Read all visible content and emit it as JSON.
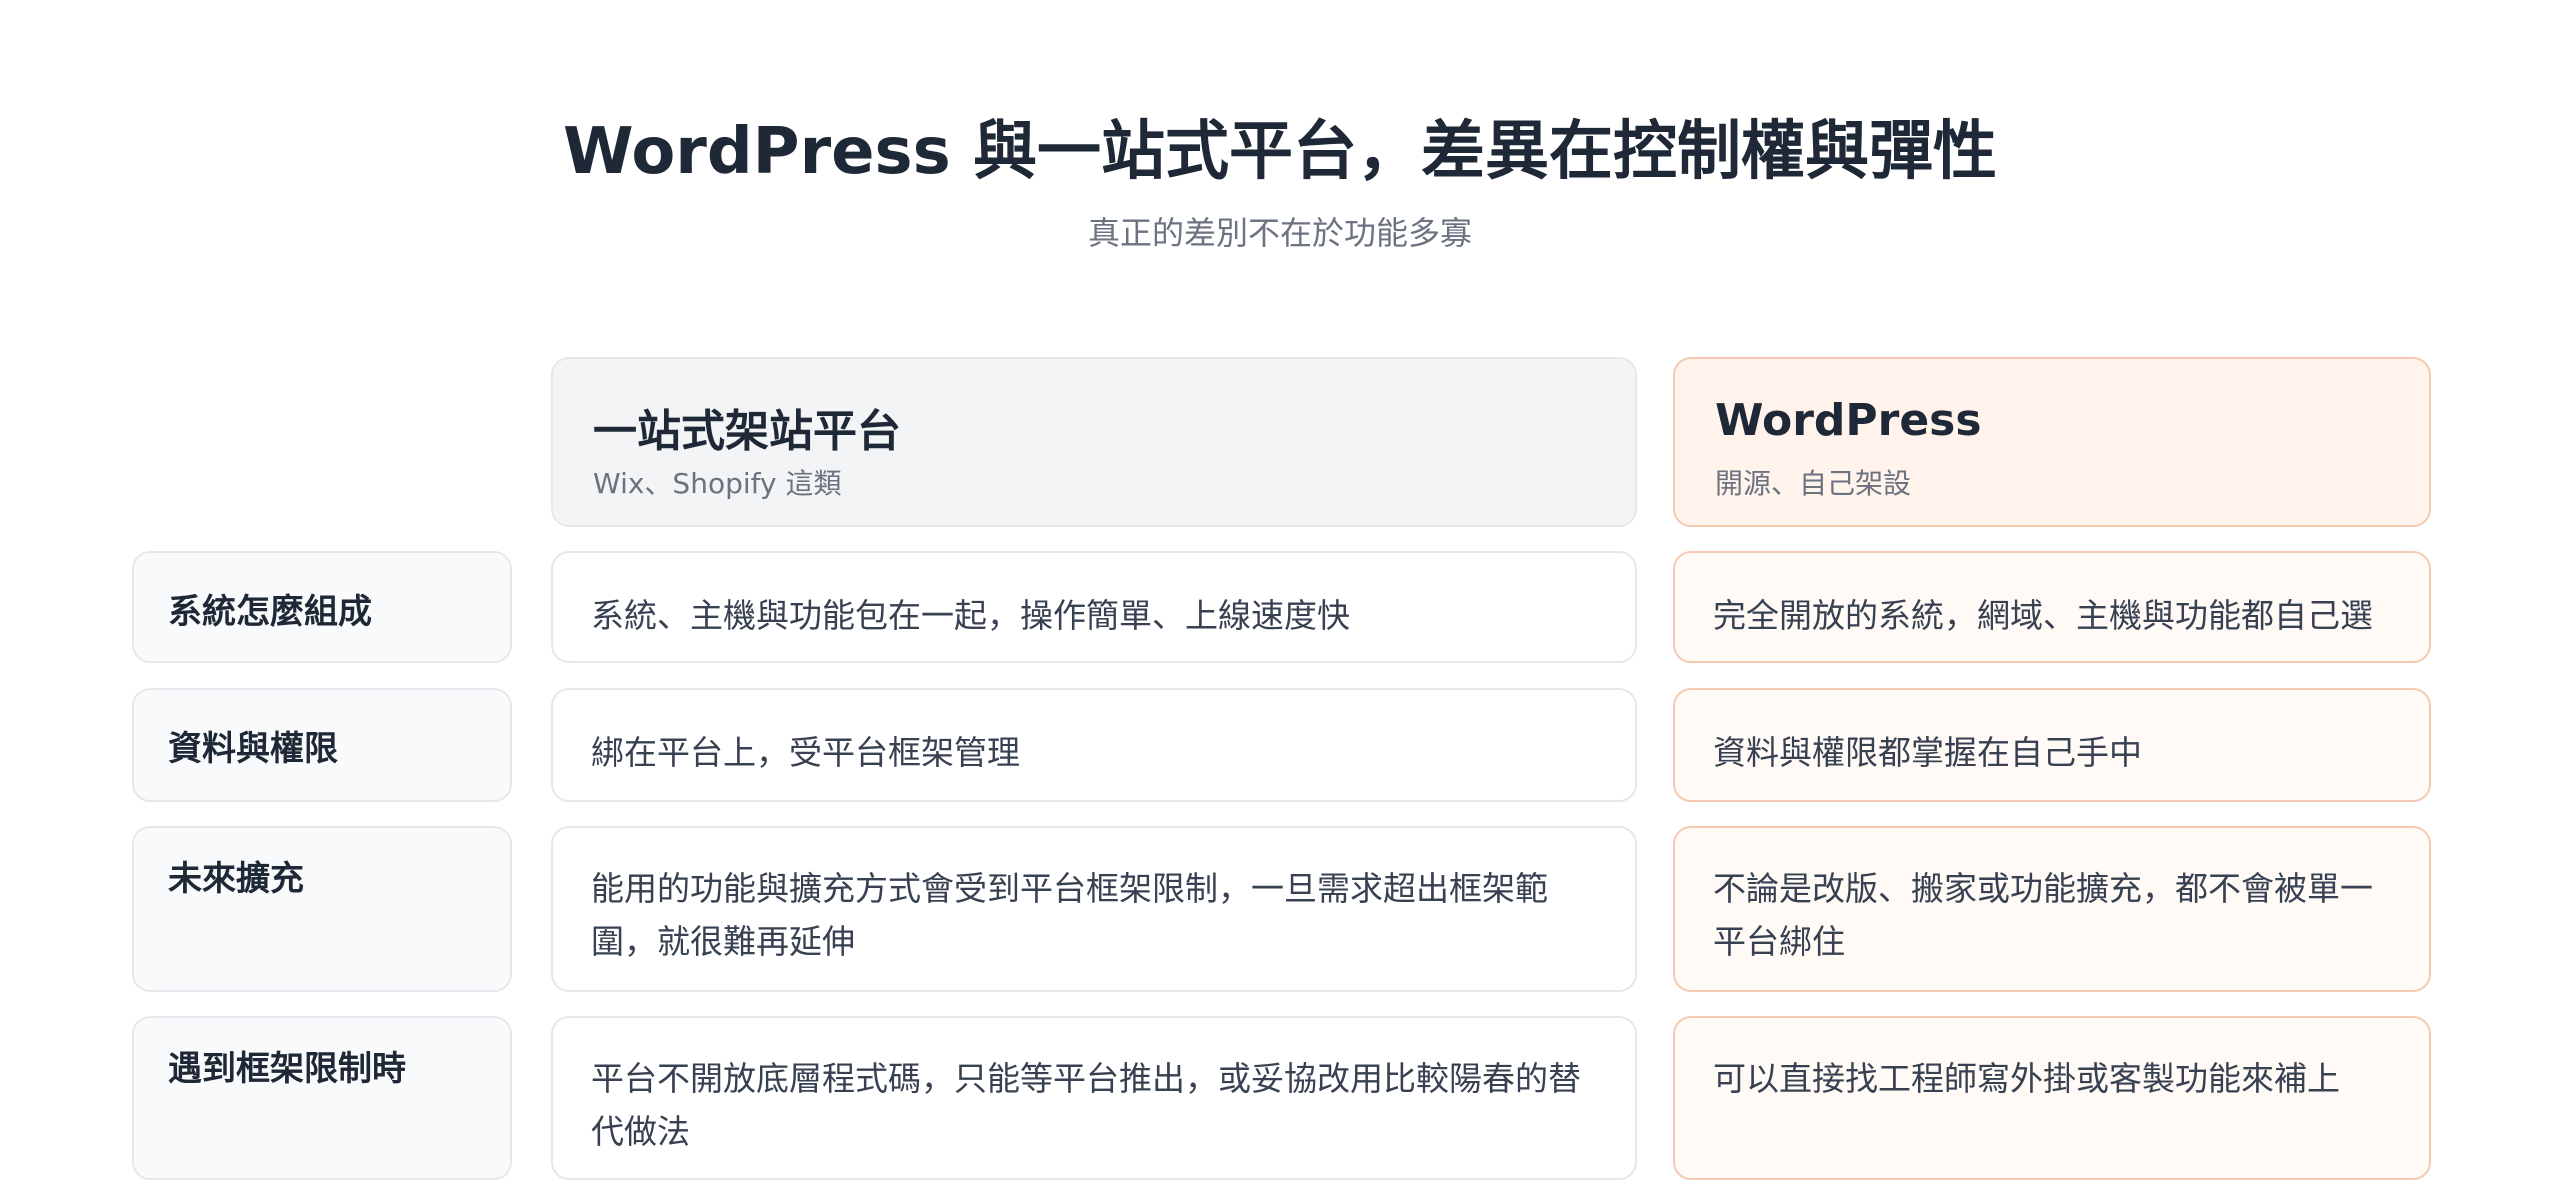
{
  "header": {
    "title": "WordPress 與一站式平台，差異在控制權與彈性",
    "subtitle": "真正的差別不在於功能多寡"
  },
  "columns": [
    {
      "title": "一站式架站平台",
      "subtitle": "Wix、Shopify 這類"
    },
    {
      "title": "WordPress",
      "subtitle": "開源、自己架設"
    }
  ],
  "rows": [
    {
      "label": "系統怎麼組成",
      "platform": "系統、主機與功能包在一起，操作簡單、上線速度快",
      "wordpress": "完全開放的系統，網域、主機與功能都自己選"
    },
    {
      "label": "資料與權限",
      "platform": "綁在平台上，受平台框架管理",
      "wordpress": "資料與權限都掌握在自己手中"
    },
    {
      "label": "未來擴充",
      "platform": "能用的功能與擴充方式會受到平台框架限制，一旦需求超出框架範圍，就很難再延伸",
      "wordpress": "不論是改版、搬家或功能擴充，都不會被單一平台綁住"
    },
    {
      "label": "遇到框架限制時",
      "platform": "平台不開放底層程式碼，只能等平台推出，或妥協改用比較陽春的替代做法",
      "wordpress": "可以直接找工程師寫外掛或客製功能來補上"
    }
  ],
  "colors": {
    "accent_border": "#f5c9b0",
    "accent_bg": "#fff3ec",
    "neutral_bg": "#f3f4f6",
    "text_dark": "#1e2836",
    "text_muted": "#6b7280"
  }
}
